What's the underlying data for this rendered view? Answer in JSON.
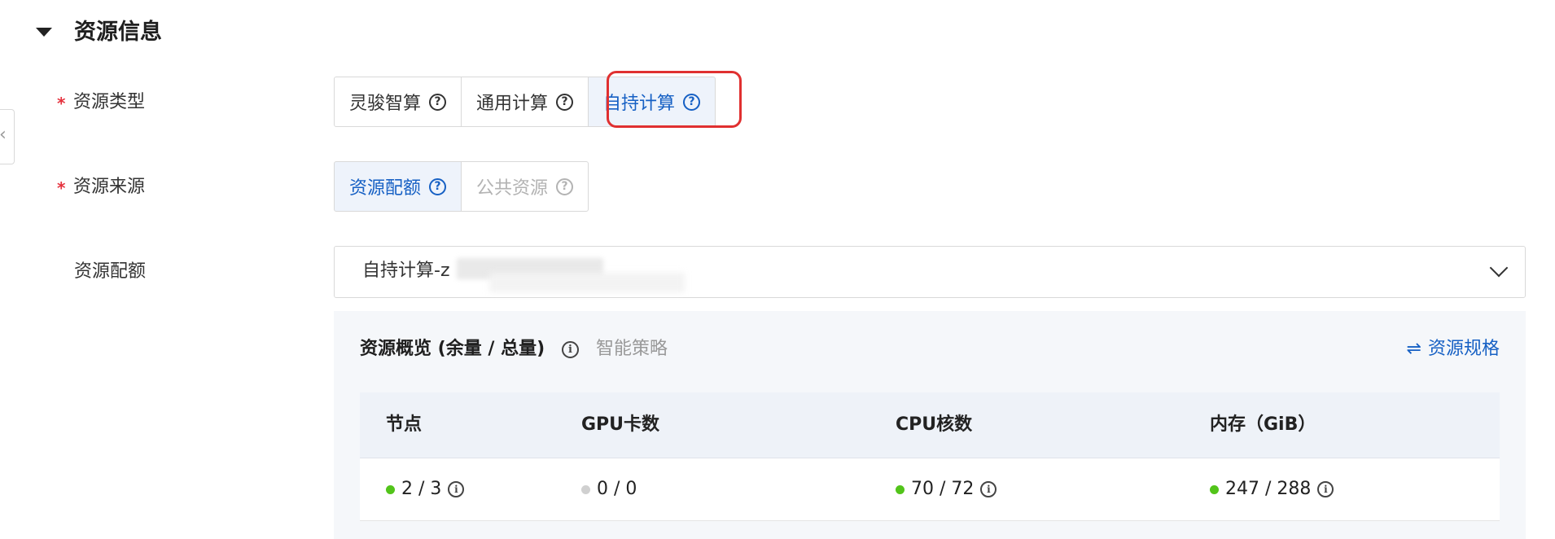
{
  "section": {
    "title": "资源信息"
  },
  "resource_type": {
    "label": "资源类型",
    "required_mark": "*",
    "options": [
      {
        "label": "灵骏智算",
        "state": "normal"
      },
      {
        "label": "通用计算",
        "state": "normal"
      },
      {
        "label": "自持计算",
        "state": "selected"
      }
    ]
  },
  "resource_source": {
    "label": "资源来源",
    "required_mark": "*",
    "options": [
      {
        "label": "资源配额",
        "state": "selected"
      },
      {
        "label": "公共资源",
        "state": "disabled"
      }
    ]
  },
  "resource_quota": {
    "label": "资源配额",
    "selected_value": "自持计算-z"
  },
  "overview": {
    "title": "资源概览 (余量 / 总量)",
    "subtitle": "智能策略",
    "spec_link": "资源规格",
    "columns": [
      "节点",
      "GPU卡数",
      "CPU核数",
      "内存（GiB）"
    ],
    "row": [
      {
        "value": "2 / 3",
        "status": "green"
      },
      {
        "value": "0 / 0",
        "status": "gray"
      },
      {
        "value": "70 / 72",
        "status": "green"
      },
      {
        "value": "247 / 288",
        "status": "green"
      }
    ]
  },
  "colors": {
    "accent": "#1660c4",
    "required": "#e5323e",
    "highlight": "#e03030",
    "status_green": "#52c41a",
    "status_gray": "#d0d0d0"
  },
  "icons": [
    "caret-down-icon",
    "chevron-left-icon",
    "help-circle-icon",
    "info-circle-icon",
    "chevron-down-icon",
    "swap-icon"
  ]
}
